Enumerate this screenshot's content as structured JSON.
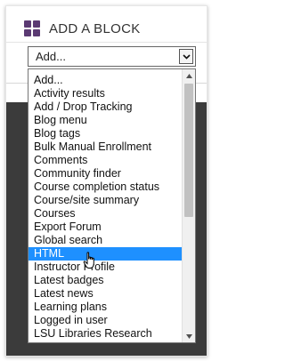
{
  "block": {
    "title": "ADD A BLOCK",
    "icon": "blocks-grid-icon"
  },
  "select": {
    "value": "Add...",
    "arrow_icon": "chevron-down-icon"
  },
  "dropdown": {
    "selected_index": 13,
    "options": [
      "Add...",
      "Activity results",
      "Add / Drop Tracking",
      "Blog menu",
      "Blog tags",
      "Bulk Manual Enrollment",
      "Comments",
      "Community finder",
      "Course completion status",
      "Course/site summary",
      "Courses",
      "Export Forum",
      "Global search",
      "HTML",
      "Instructor Profile",
      "Latest badges",
      "Latest news",
      "Learning plans",
      "Logged in user",
      "LSU Libraries Research"
    ]
  },
  "colors": {
    "accent": "#5b3a73",
    "highlight": "#1e90ff",
    "dark_background": "#3b3b3b"
  }
}
